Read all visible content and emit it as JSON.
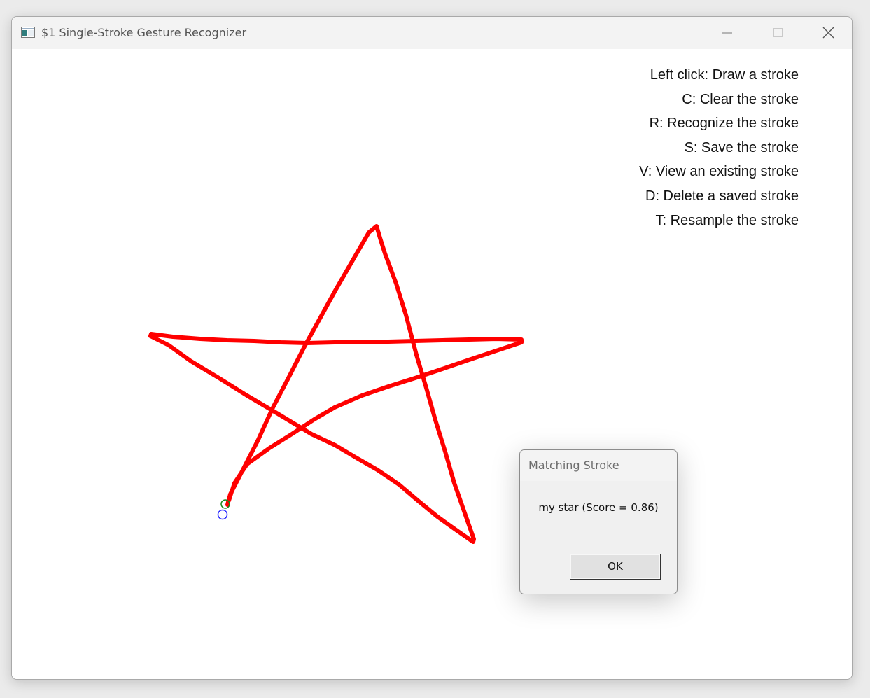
{
  "window": {
    "title": "$1 Single-Stroke Gesture Recognizer",
    "icon": "app-window-icon",
    "controls": [
      "minimize-icon",
      "maximize-icon",
      "close-icon"
    ]
  },
  "instructions": [
    "Left click: Draw a stroke",
    "C: Clear the stroke",
    "R: Recognize the stroke",
    "S: Save the stroke",
    "V: View an existing stroke",
    "D: Delete a saved stroke",
    "T: Resample the stroke"
  ],
  "stroke": {
    "color": "#ff0000",
    "start_marker_color": "#1a8a1a",
    "end_marker_color": "#1f1fff"
  },
  "dialog": {
    "title": "Matching Stroke",
    "message": "my star (Score = 0.86)",
    "ok_label": "OK"
  }
}
